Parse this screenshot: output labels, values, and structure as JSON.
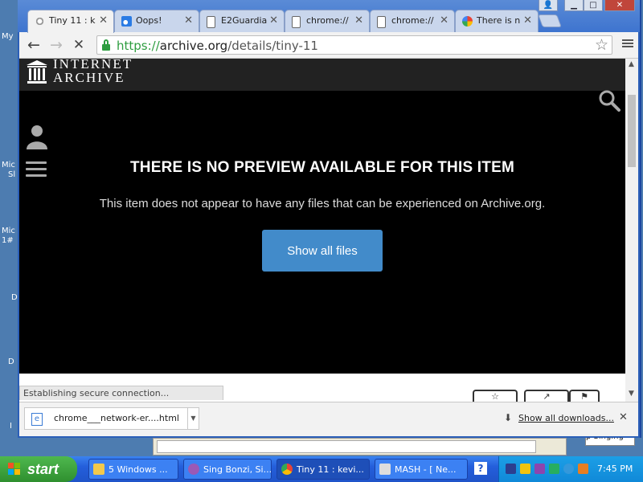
{
  "desktop": {
    "labels": [
      "My",
      "Mic",
      "Sl",
      "Mic",
      "1#",
      "D",
      "D",
      "I"
    ]
  },
  "browser": {
    "tabs": [
      {
        "label": "Tiny 11 : k",
        "icon": "loading-icon",
        "active": true
      },
      {
        "label": "Oops!",
        "icon": "edge-like-icon",
        "active": false
      },
      {
        "label": "E2Guardia",
        "icon": "document-icon",
        "active": false
      },
      {
        "label": "chrome://",
        "icon": "document-icon",
        "active": false
      },
      {
        "label": "chrome://",
        "icon": "document-icon",
        "active": false
      },
      {
        "label": "There is n",
        "icon": "google-icon",
        "active": false
      }
    ],
    "url": {
      "scheme": "https://",
      "host": "archive.org",
      "path": "/details/tiny-11"
    }
  },
  "page": {
    "logo_line1": "INTERNET",
    "logo_line2": "ARCHIVE",
    "headline": "THERE IS NO PREVIEW AVAILABLE FOR THIS ITEM",
    "subline": "This item does not appear to have any files that can be experienced on Archive.org.",
    "button_label": "Show all files"
  },
  "status": "Establishing secure connection...",
  "downloads": {
    "file_name": "chrome___network-er....html",
    "show_all": "Show all downloads..."
  },
  "bg_window": {
    "right_label": "p Singing"
  },
  "taskbar": {
    "start_label": "start",
    "buttons": [
      {
        "label": "5 Windows ...",
        "icon": "folder-icon"
      },
      {
        "label": "Sing Bonzi, Si...",
        "icon": "bonzi-icon"
      },
      {
        "label": "Tiny 11 : kevi...",
        "icon": "chrome-icon"
      },
      {
        "label": "MASH - [ Ne...",
        "icon": "mash-icon"
      }
    ],
    "clock": "7:45 PM"
  },
  "colors": {
    "accent": "#428bca",
    "secure": "#2d9d3f",
    "start": "#3a9a3a",
    "taskbar": "#245edb"
  }
}
